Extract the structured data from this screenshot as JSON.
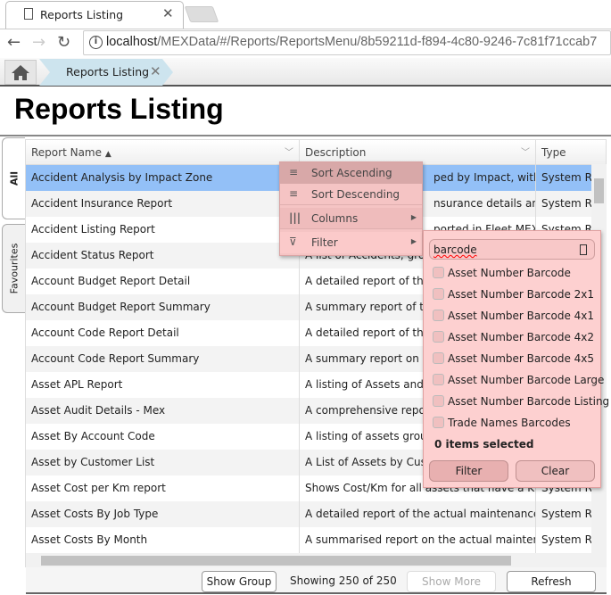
{
  "browser": {
    "tab_title": "Reports Listing",
    "url_host": "localhost",
    "url_path": "/MEXData/#/Reports/ReportsMenu/8b59211d-f894-4c80-9246-7c81f71ccab7"
  },
  "breadcrumb": {
    "current": "Reports Listing"
  },
  "page": {
    "title": "Reports Listing"
  },
  "side_tabs": {
    "all": "All",
    "favourites": "Favourites"
  },
  "grid": {
    "columns": [
      "Report Name",
      "Description",
      "Type"
    ],
    "sort_indicator": "▲",
    "rows": [
      {
        "name": "Accident Analysis by Impact Zone",
        "desc": "ped by Impact, with...",
        "type": "System Re"
      },
      {
        "name": "Accident Insurance Report",
        "desc": "nsurance details an...",
        "type": "System Re"
      },
      {
        "name": "Accident Listing Report",
        "desc": "ported in Fleet MEX...",
        "type": "System Re"
      },
      {
        "name": "Accident Status Report",
        "desc": "A list of Accidents, group",
        "type": ""
      },
      {
        "name": "Account Budget Report Detail",
        "desc": "A detailed report of the",
        "type": ""
      },
      {
        "name": "Account Budget Report Summary",
        "desc": "A summary report of the",
        "type": ""
      },
      {
        "name": "Account Code Report Detail",
        "desc": "A detailed report of the",
        "type": ""
      },
      {
        "name": "Account Code Report Summary",
        "desc": "A summary report on th",
        "type": ""
      },
      {
        "name": "Asset APL Report",
        "desc": "A listing of Assets and th",
        "type": ""
      },
      {
        "name": "Asset Audit Details - Mex",
        "desc": "A comprehensive report",
        "type": ""
      },
      {
        "name": "Asset By Account Code",
        "desc": "A listing of assets group",
        "type": ""
      },
      {
        "name": "Asset by Customer List",
        "desc": "A List of Assets by Custo",
        "type": ""
      },
      {
        "name": "Asset Cost per Km report",
        "desc": "Shows Cost/Km for all assets that have a K...",
        "type": "System Re"
      },
      {
        "name": "Asset Costs By Job Type",
        "desc": "A detailed report of the actual maintenance...",
        "type": "System Re"
      },
      {
        "name": "Asset Costs By Month",
        "desc": "A summarised report on the actual mainten...",
        "type": "System Re"
      }
    ]
  },
  "column_menu": {
    "sort_asc": "Sort Ascending",
    "sort_desc": "Sort Descending",
    "columns": "Columns",
    "filter": "Filter"
  },
  "filter_popup": {
    "search_value": "barcode",
    "items": [
      "Asset Number Barcode",
      "Asset Number Barcode 2x1",
      "Asset Number Barcode 4x1",
      "Asset Number Barcode 4x2",
      "Asset Number Barcode 4x5",
      "Asset Number Barcode Large",
      "Asset Number Barcode Listing",
      "Trade Names Barcodes"
    ],
    "selected_text": "0 items selected",
    "filter_button": "Filter",
    "clear_button": "Clear"
  },
  "footer": {
    "show_group": "Show Group",
    "status": "Showing 250 of 250",
    "show_more": "Show More",
    "refresh": "Refresh"
  },
  "colors": {
    "selected_row": "#93c0f7",
    "menu_bg": "#f5c4c4",
    "popup_bg": "#fdd0d0"
  }
}
